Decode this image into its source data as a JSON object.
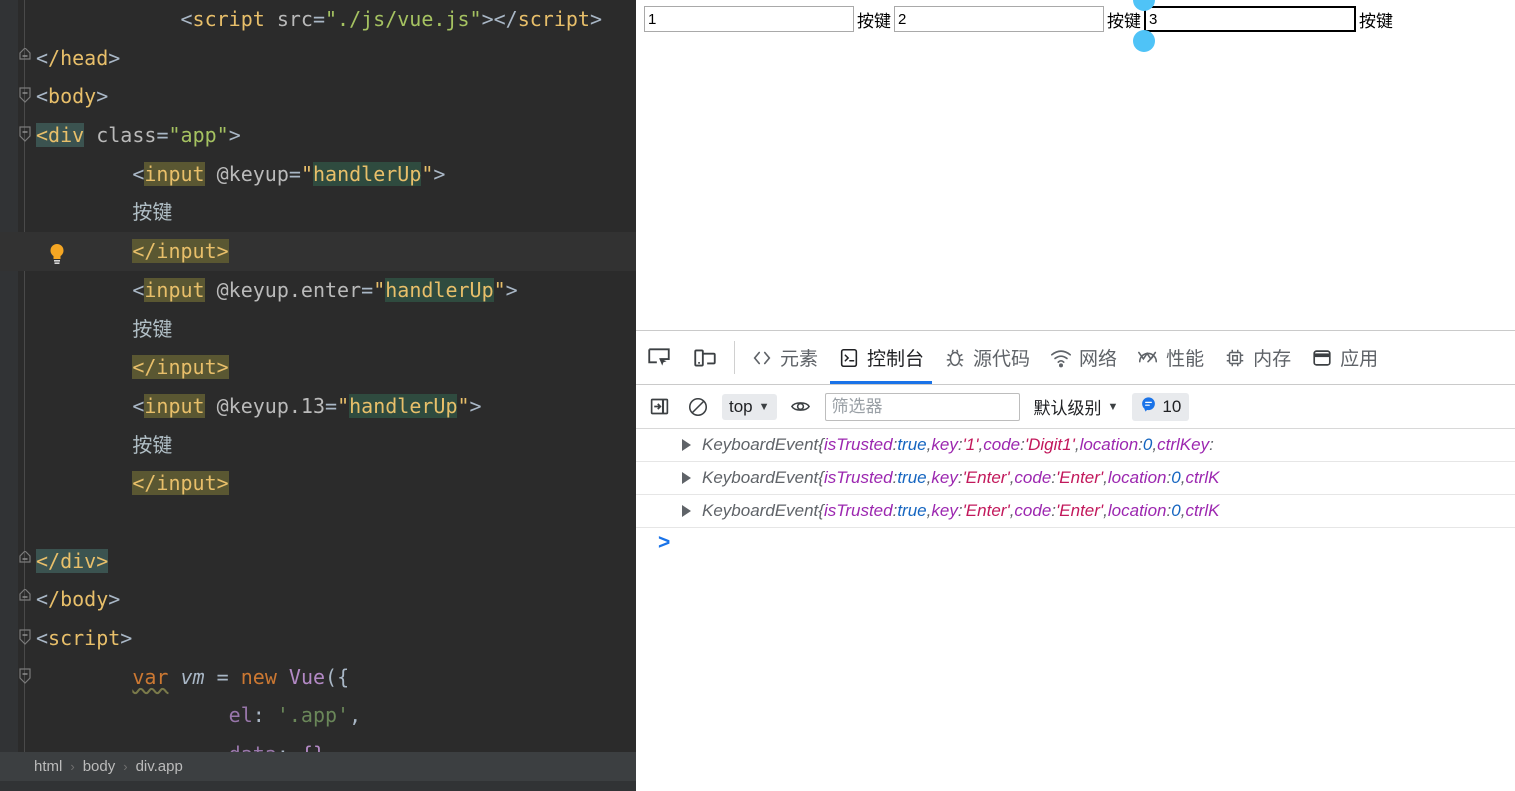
{
  "editor": {
    "lines": [
      {
        "indent": 3,
        "tokens": [
          {
            "t": "punct",
            "s": "<"
          },
          {
            "t": "tag",
            "s": "script"
          },
          {
            "t": "sp",
            "s": " "
          },
          {
            "t": "attr",
            "s": "src"
          },
          {
            "t": "punct",
            "s": "="
          },
          {
            "t": "str",
            "s": "\"./js/vue.js\""
          },
          {
            "t": "punct",
            "s": ">"
          },
          {
            "t": "punct",
            "s": "<"
          },
          {
            "t": "punct",
            "s": "/"
          },
          {
            "t": "tag",
            "s": "script"
          },
          {
            "t": "punct",
            "s": ">"
          }
        ]
      },
      {
        "indent": 0,
        "fold": "end",
        "tokens": [
          {
            "t": "punct",
            "s": "<"
          },
          {
            "t": "tag",
            "s": "/head"
          },
          {
            "t": "punct",
            "s": ">"
          }
        ]
      },
      {
        "indent": 0,
        "fold": "start",
        "tokens": [
          {
            "t": "punct",
            "s": "<"
          },
          {
            "t": "tag",
            "s": "body"
          },
          {
            "t": "punct",
            "s": ">"
          }
        ]
      },
      {
        "indent": 0,
        "fold": "start",
        "tokens": [
          {
            "t": "hlC",
            "s": "<div"
          },
          {
            "t": "sp",
            "s": " "
          },
          {
            "t": "attr",
            "s": "class"
          },
          {
            "t": "punct",
            "s": "="
          },
          {
            "t": "str",
            "s": "\"app\""
          },
          {
            "t": "punct",
            "s": ">"
          }
        ]
      },
      {
        "indent": 2,
        "tokens": [
          {
            "t": "punct",
            "s": "<"
          },
          {
            "t": "hlA-tag",
            "s": "input"
          },
          {
            "t": "sp",
            "s": " "
          },
          {
            "t": "attr",
            "s": "@keyup"
          },
          {
            "t": "punct",
            "s": "="
          },
          {
            "t": "strq",
            "s": "\""
          },
          {
            "t": "hlB-val",
            "s": "handlerUp"
          },
          {
            "t": "strq",
            "s": "\""
          },
          {
            "t": "punct",
            "s": ">"
          }
        ]
      },
      {
        "indent": 2,
        "tokens": [
          {
            "t": "greytext",
            "s": "按键"
          }
        ]
      },
      {
        "indent": 2,
        "hl": true,
        "bulb": true,
        "tokens": [
          {
            "t": "hlA-tag",
            "s": "</input>"
          }
        ]
      },
      {
        "indent": 2,
        "tokens": [
          {
            "t": "punct",
            "s": "<"
          },
          {
            "t": "hlA-tag",
            "s": "input"
          },
          {
            "t": "sp",
            "s": " "
          },
          {
            "t": "attr",
            "s": "@keyup.enter"
          },
          {
            "t": "punct",
            "s": "="
          },
          {
            "t": "strq",
            "s": "\""
          },
          {
            "t": "hlB-val",
            "s": "handlerUp"
          },
          {
            "t": "strq",
            "s": "\""
          },
          {
            "t": "punct",
            "s": ">"
          }
        ]
      },
      {
        "indent": 2,
        "tokens": [
          {
            "t": "greytext",
            "s": "按键"
          }
        ]
      },
      {
        "indent": 2,
        "tokens": [
          {
            "t": "hlA-tag",
            "s": "</input>"
          }
        ]
      },
      {
        "indent": 2,
        "tokens": [
          {
            "t": "punct",
            "s": "<"
          },
          {
            "t": "hlA-tag",
            "s": "input"
          },
          {
            "t": "sp",
            "s": " "
          },
          {
            "t": "attr",
            "s": "@keyup.13"
          },
          {
            "t": "punct",
            "s": "="
          },
          {
            "t": "strq",
            "s": "\""
          },
          {
            "t": "hlB-val",
            "s": "handlerUp"
          },
          {
            "t": "strq",
            "s": "\""
          },
          {
            "t": "punct",
            "s": ">"
          }
        ]
      },
      {
        "indent": 2,
        "tokens": [
          {
            "t": "greytext",
            "s": "按键"
          }
        ]
      },
      {
        "indent": 2,
        "tokens": [
          {
            "t": "hlA-tag",
            "s": "</input>"
          }
        ]
      },
      {
        "indent": 0,
        "tokens": []
      },
      {
        "indent": 0,
        "fold": "end",
        "tokens": [
          {
            "t": "hlC2",
            "s": "</div>"
          }
        ]
      },
      {
        "indent": 0,
        "fold": "end",
        "tokens": [
          {
            "t": "punct",
            "s": "<"
          },
          {
            "t": "tag",
            "s": "/body"
          },
          {
            "t": "punct",
            "s": ">"
          }
        ]
      },
      {
        "indent": 0,
        "fold": "start",
        "tokens": [
          {
            "t": "punct",
            "s": "<"
          },
          {
            "t": "tag",
            "s": "script"
          },
          {
            "t": "punct",
            "s": ">"
          }
        ]
      },
      {
        "indent": 2,
        "fold": "start",
        "tokens": [
          {
            "t": "kw-wavy",
            "s": "var"
          },
          {
            "t": "sp",
            "s": " "
          },
          {
            "t": "var",
            "s": "vm"
          },
          {
            "t": "sp",
            "s": " "
          },
          {
            "t": "punct",
            "s": "="
          },
          {
            "t": "sp",
            "s": " "
          },
          {
            "t": "kw",
            "s": "new"
          },
          {
            "t": "sp",
            "s": " "
          },
          {
            "t": "cls",
            "s": "Vue"
          },
          {
            "t": "punct",
            "s": "({"
          }
        ]
      },
      {
        "indent": 4,
        "tokens": [
          {
            "t": "prop",
            "s": "el"
          },
          {
            "t": "punct",
            "s": ": "
          },
          {
            "t": "strs",
            "s": "'.app'"
          },
          {
            "t": "punct",
            "s": ","
          }
        ]
      },
      {
        "indent": 4,
        "tokens": [
          {
            "t": "prop",
            "s": "data"
          },
          {
            "t": "punct",
            "s": ": "
          },
          {
            "t": "cls",
            "s": "{}"
          }
        ]
      }
    ],
    "breadcrumb": {
      "items": [
        "html",
        "body",
        "div.app"
      ],
      "separator": "›"
    }
  },
  "browser": {
    "page": {
      "fields": [
        {
          "value": "1",
          "label": "按键",
          "focused": false
        },
        {
          "value": "2",
          "label": "按键",
          "focused": false
        },
        {
          "value": "3",
          "label": "按键",
          "focused": true
        }
      ]
    }
  },
  "devtools": {
    "toolbar": {
      "inspect_title": "inspect-element",
      "device_title": "device-toolbar"
    },
    "tabs": [
      {
        "id": "elements",
        "label": "元素",
        "icon": "code-brackets-icon",
        "active": false
      },
      {
        "id": "console",
        "label": "控制台",
        "icon": "console-icon",
        "active": true
      },
      {
        "id": "sources",
        "label": "源代码",
        "icon": "bug-icon",
        "active": false
      },
      {
        "id": "network",
        "label": "网络",
        "icon": "wifi-icon",
        "active": false
      },
      {
        "id": "performance",
        "label": "性能",
        "icon": "gauge-icon",
        "active": false
      },
      {
        "id": "memory",
        "label": "内存",
        "icon": "chip-icon",
        "active": false
      },
      {
        "id": "application",
        "label": "应用",
        "icon": "window-icon",
        "active": false
      }
    ],
    "console_toolbar": {
      "sidebar_icon": "panel-toggle-icon",
      "clear_icon": "clear-console-icon",
      "context": "top",
      "eye_icon": "live-expression-icon",
      "filter_placeholder": "筛选器",
      "filter_value": "",
      "level_label": "默认级别",
      "message_count": "10",
      "message_icon": "speech-bubble-icon",
      "badge_color": "#1a73e8"
    },
    "console_logs": [
      {
        "cls": "KeyboardEvent",
        "parts": [
          {
            "t": "brace",
            "s": " {"
          },
          {
            "t": "key",
            "s": "isTrusted"
          },
          {
            "t": "brace",
            "s": ": "
          },
          {
            "t": "bool",
            "s": "true"
          },
          {
            "t": "brace",
            "s": ", "
          },
          {
            "t": "key",
            "s": "key"
          },
          {
            "t": "brace",
            "s": ": "
          },
          {
            "t": "str",
            "s": "'1'"
          },
          {
            "t": "brace",
            "s": ", "
          },
          {
            "t": "key",
            "s": "code"
          },
          {
            "t": "brace",
            "s": ": "
          },
          {
            "t": "str",
            "s": "'Digit1'"
          },
          {
            "t": "brace",
            "s": ", "
          },
          {
            "t": "key",
            "s": "location"
          },
          {
            "t": "brace",
            "s": ": "
          },
          {
            "t": "num",
            "s": "0"
          },
          {
            "t": "brace",
            "s": ", "
          },
          {
            "t": "key",
            "s": "ctrlKey"
          },
          {
            "t": "brace",
            "s": ":"
          }
        ]
      },
      {
        "cls": "KeyboardEvent",
        "parts": [
          {
            "t": "brace",
            "s": " {"
          },
          {
            "t": "key",
            "s": "isTrusted"
          },
          {
            "t": "brace",
            "s": ": "
          },
          {
            "t": "bool",
            "s": "true"
          },
          {
            "t": "brace",
            "s": ", "
          },
          {
            "t": "key",
            "s": "key"
          },
          {
            "t": "brace",
            "s": ": "
          },
          {
            "t": "str",
            "s": "'Enter'"
          },
          {
            "t": "brace",
            "s": ", "
          },
          {
            "t": "key",
            "s": "code"
          },
          {
            "t": "brace",
            "s": ": "
          },
          {
            "t": "str",
            "s": "'Enter'"
          },
          {
            "t": "brace",
            "s": ", "
          },
          {
            "t": "key",
            "s": "location"
          },
          {
            "t": "brace",
            "s": ": "
          },
          {
            "t": "num",
            "s": "0"
          },
          {
            "t": "brace",
            "s": ", "
          },
          {
            "t": "key",
            "s": "ctrlK"
          }
        ]
      },
      {
        "cls": "KeyboardEvent",
        "parts": [
          {
            "t": "brace",
            "s": " {"
          },
          {
            "t": "key",
            "s": "isTrusted"
          },
          {
            "t": "brace",
            "s": ": "
          },
          {
            "t": "bool",
            "s": "true"
          },
          {
            "t": "brace",
            "s": ", "
          },
          {
            "t": "key",
            "s": "key"
          },
          {
            "t": "brace",
            "s": ": "
          },
          {
            "t": "str",
            "s": "'Enter'"
          },
          {
            "t": "brace",
            "s": ", "
          },
          {
            "t": "key",
            "s": "code"
          },
          {
            "t": "brace",
            "s": ": "
          },
          {
            "t": "str",
            "s": "'Enter'"
          },
          {
            "t": "brace",
            "s": ", "
          },
          {
            "t": "key",
            "s": "location"
          },
          {
            "t": "brace",
            "s": ": "
          },
          {
            "t": "num",
            "s": "0"
          },
          {
            "t": "brace",
            "s": ", "
          },
          {
            "t": "key",
            "s": "ctrlK"
          }
        ]
      }
    ],
    "prompt": ">"
  },
  "colors": {
    "editor_bg": "#2b2b2b",
    "editor_line_hl": "#323232",
    "gutter_bg": "#313335",
    "breadcrumb_bg": "#3c3f41",
    "accent_blue": "#1a73e8",
    "selection_handle": "#4fc3f7",
    "token_tag": "#e8bf6a",
    "token_string": "#a5c261",
    "token_keyword": "#cc7832"
  }
}
